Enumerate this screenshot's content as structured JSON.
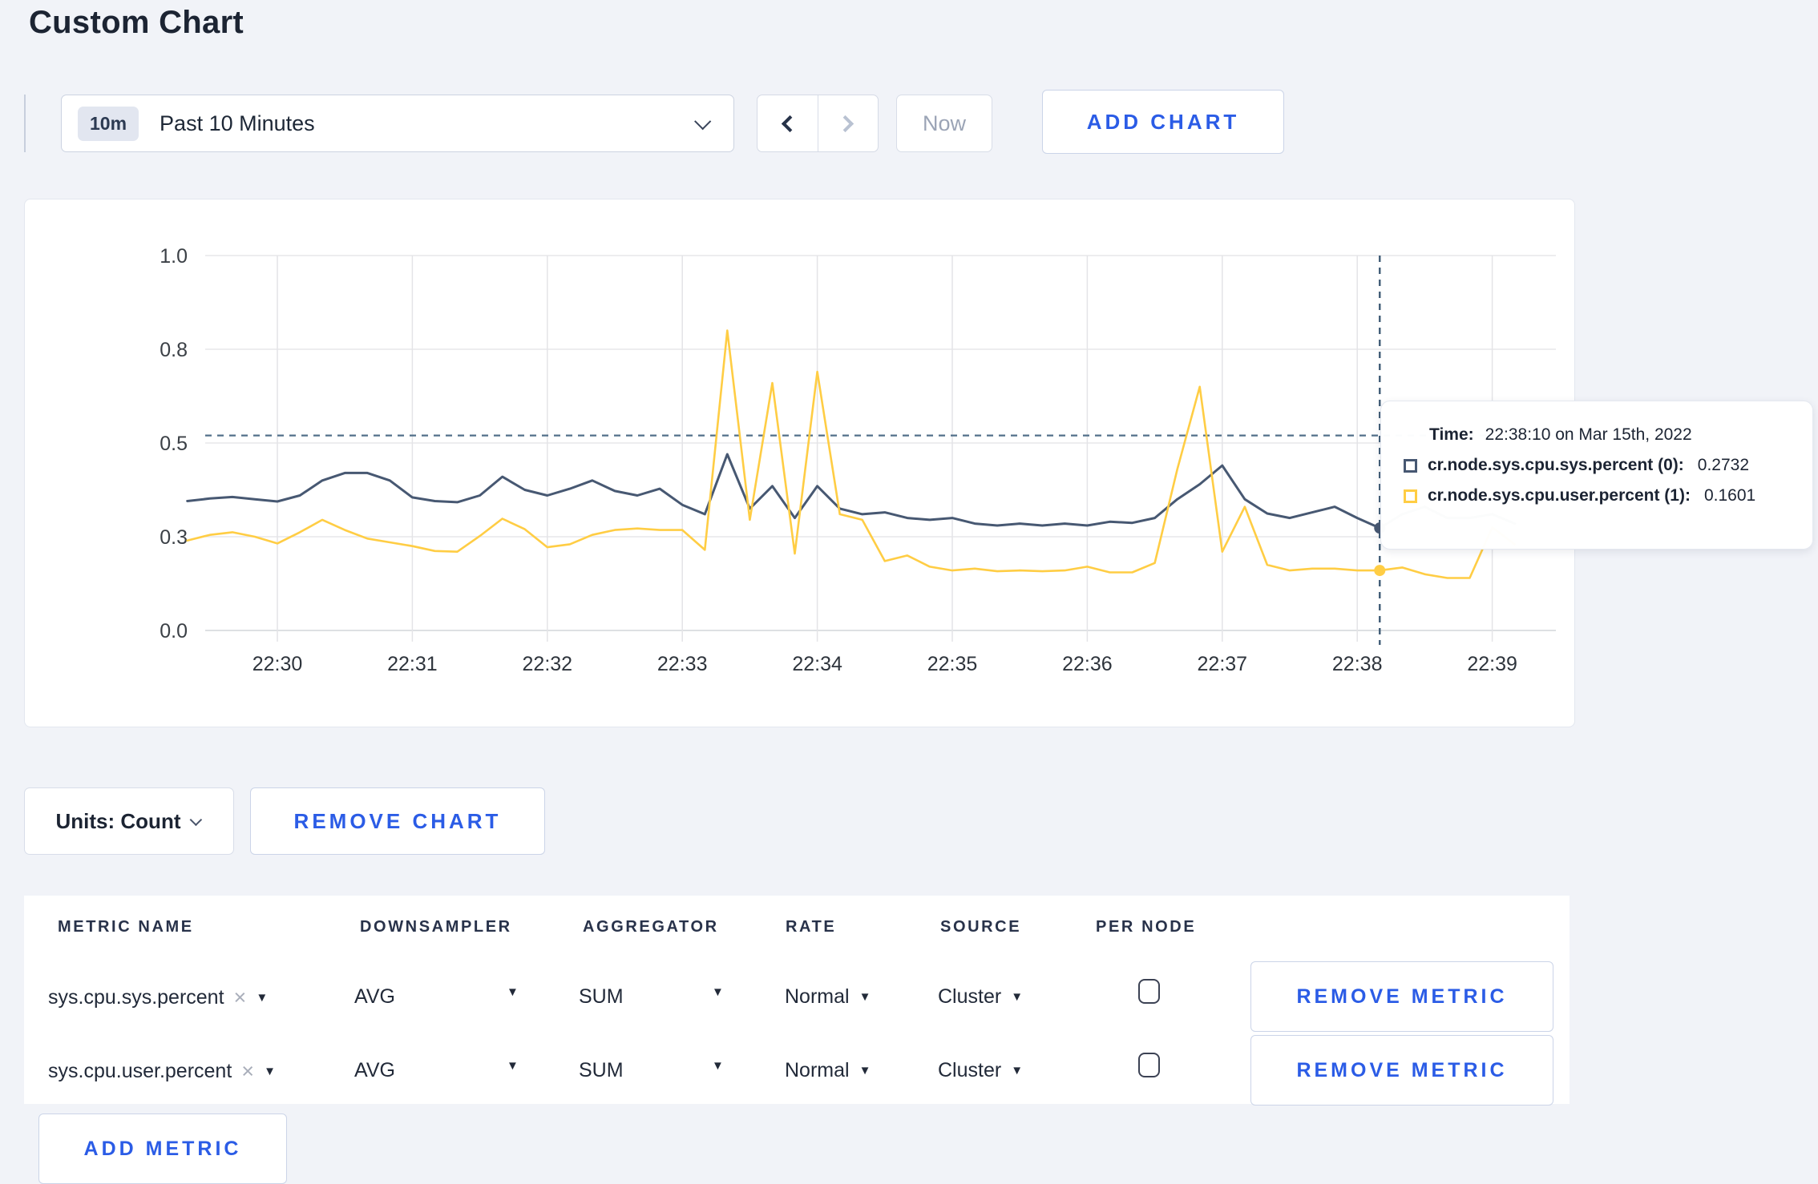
{
  "page": {
    "title": "Custom Chart",
    "background": "#f1f3f8",
    "accent_blue": "#2b5ce6"
  },
  "toolbar": {
    "time_range_badge": "10m",
    "time_range_label": "Past 10 Minutes",
    "now_label": "Now",
    "add_chart_label": "ADD CHART"
  },
  "chart_data": {
    "type": "line",
    "title": "",
    "xlabel": "",
    "ylabel": "",
    "ylim": [
      0,
      1
    ],
    "grid": true,
    "x_ticks": [
      "22:30",
      "22:31",
      "22:32",
      "22:33",
      "22:34",
      "22:35",
      "22:36",
      "22:37",
      "22:38",
      "22:39"
    ],
    "y_ticks": [
      {
        "value": 1.0,
        "label": "1.0"
      },
      {
        "value": 0.75,
        "label": "0.8"
      },
      {
        "value": 0.5,
        "label": "0.5"
      },
      {
        "value": 0.25,
        "label": "0.3"
      },
      {
        "value": 0.0,
        "label": "0.0"
      }
    ],
    "points_start_time": "22:29:20",
    "point_interval_seconds": 10,
    "series": [
      {
        "name": "cr.node.sys.cpu.sys.percent (0)",
        "color": "#475872",
        "values": [
          0.345,
          0.352,
          0.356,
          0.35,
          0.344,
          0.36,
          0.4,
          0.42,
          0.42,
          0.4,
          0.355,
          0.345,
          0.342,
          0.36,
          0.41,
          0.375,
          0.36,
          0.378,
          0.4,
          0.372,
          0.36,
          0.378,
          0.335,
          0.31,
          0.47,
          0.325,
          0.385,
          0.3,
          0.385,
          0.325,
          0.31,
          0.315,
          0.3,
          0.295,
          0.3,
          0.285,
          0.28,
          0.285,
          0.28,
          0.285,
          0.28,
          0.29,
          0.287,
          0.3,
          0.35,
          0.39,
          0.44,
          0.35,
          0.312,
          0.3,
          0.315,
          0.33,
          0.3,
          0.2732,
          0.31,
          0.33,
          0.3,
          0.3,
          0.31,
          0.285
        ]
      },
      {
        "name": "cr.node.sys.cpu.user.percent (1)",
        "color": "#FFCD44",
        "values": [
          0.24,
          0.255,
          0.262,
          0.25,
          0.232,
          0.262,
          0.295,
          0.268,
          0.245,
          0.235,
          0.225,
          0.212,
          0.21,
          0.252,
          0.298,
          0.27,
          0.222,
          0.23,
          0.255,
          0.268,
          0.272,
          0.268,
          0.268,
          0.215,
          0.8,
          0.295,
          0.66,
          0.205,
          0.69,
          0.31,
          0.295,
          0.185,
          0.2,
          0.17,
          0.16,
          0.165,
          0.158,
          0.16,
          0.158,
          0.16,
          0.17,
          0.155,
          0.155,
          0.18,
          0.43,
          0.65,
          0.21,
          0.33,
          0.175,
          0.16,
          0.165,
          0.165,
          0.16,
          0.1601,
          0.168,
          0.15,
          0.14,
          0.14,
          0.275,
          0.23
        ]
      }
    ],
    "crosshair": {
      "time": "22:38:10",
      "point_index": 53,
      "mouse_value": 0.52
    }
  },
  "tooltip": {
    "time_label": "Time:",
    "time_value": "22:38:10 on Mar 15th, 2022",
    "entries": [
      {
        "name": "cr.node.sys.cpu.sys.percent (0):",
        "value": "0.2732",
        "color": "#475872"
      },
      {
        "name": "cr.node.sys.cpu.user.percent (1):",
        "value": "0.1601",
        "color": "#FFCD44"
      }
    ]
  },
  "chart_controls": {
    "units_label": "Units: Count",
    "remove_chart_label": "REMOVE CHART"
  },
  "metrics_table": {
    "headers": [
      "METRIC NAME",
      "DOWNSAMPLER",
      "AGGREGATOR",
      "RATE",
      "SOURCE",
      "PER NODE"
    ],
    "rows": [
      {
        "metric_name": "sys.cpu.sys.percent",
        "downsampler": "AVG",
        "aggregator": "SUM",
        "rate": "Normal",
        "source": "Cluster",
        "per_node_checked": false,
        "remove_label": "REMOVE METRIC"
      },
      {
        "metric_name": "sys.cpu.user.percent",
        "downsampler": "AVG",
        "aggregator": "SUM",
        "rate": "Normal",
        "source": "Cluster",
        "per_node_checked": false,
        "remove_label": "REMOVE METRIC"
      }
    ],
    "add_metric_label": "ADD METRIC"
  },
  "ui": {
    "caret_down_glyph": "▼",
    "clear_glyph": "×"
  }
}
